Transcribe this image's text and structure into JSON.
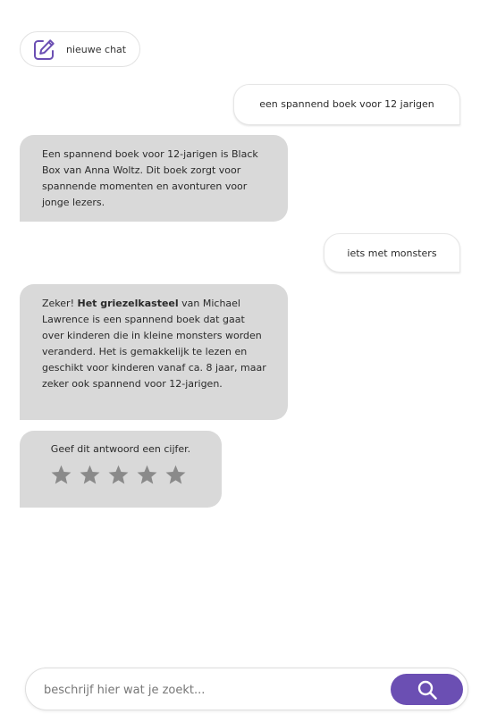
{
  "colors": {
    "accent": "#6b4fb3",
    "bot_bubble": "#d9d9d9",
    "star": "#8a8a8a"
  },
  "new_chat": {
    "icon": "edit-icon",
    "label": "nieuwe chat"
  },
  "messages": [
    {
      "role": "user",
      "text": "een spannend boek voor 12 jarigen"
    },
    {
      "role": "bot",
      "text": "Een spannend boek voor 12-jarigen is Black Box van Anna Woltz. Dit boek zorgt voor spannende momenten en avonturen voor jonge lezers."
    },
    {
      "role": "user",
      "text": "iets met monsters"
    },
    {
      "role": "bot",
      "prefix": "Zeker! ",
      "bold": "Het griezelkasteel",
      "suffix": " van Michael Lawrence is een spannend boek dat gaat over kinderen die in kleine monsters worden veranderd. Het is gemakkelijk te lezen en geschikt voor kinderen vanaf ca. 8 jaar, maar zeker ook spannend voor 12-jarigen."
    }
  ],
  "rating": {
    "prompt": "Geef dit antwoord een cijfer.",
    "max_stars": 5,
    "selected": 0,
    "icon": "star-icon"
  },
  "search": {
    "placeholder": "beschrijf hier wat je zoekt...",
    "value": "",
    "button_icon": "search-icon"
  }
}
